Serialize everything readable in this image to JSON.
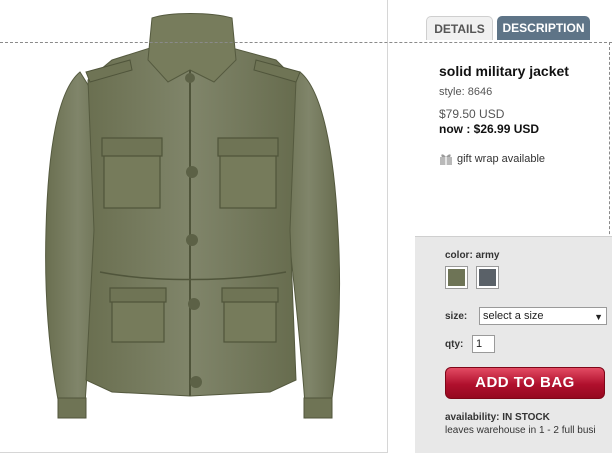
{
  "tabs": [
    {
      "label": "DETAILS"
    },
    {
      "label": "DESCRIPTION"
    }
  ],
  "product": {
    "title": "solid military jacket",
    "style": "style: 8646",
    "price_original": "$79.50 USD",
    "price_now": "now : $26.99 USD",
    "gift_wrap": "gift wrap available"
  },
  "options": {
    "color_label": "color:",
    "color_value": "army",
    "swatches": [
      {
        "name": "army",
        "color": "#6e7456"
      },
      {
        "name": "grey",
        "color": "#5a6168"
      }
    ],
    "size_label": "size:",
    "size_selected": "select a size",
    "qty_label": "qty:",
    "qty_value": "1",
    "add_to_bag_label": "ADD TO BAG"
  },
  "availability": {
    "label": "availability:",
    "value": "IN STOCK",
    "leaves": "leaves warehouse in 1 - 2 full busi"
  },
  "colors": {
    "tab_active": "#5e7487",
    "button": "#b0102d",
    "options_panel": "#e8e8e8",
    "jacket": "#7a7f5e"
  }
}
